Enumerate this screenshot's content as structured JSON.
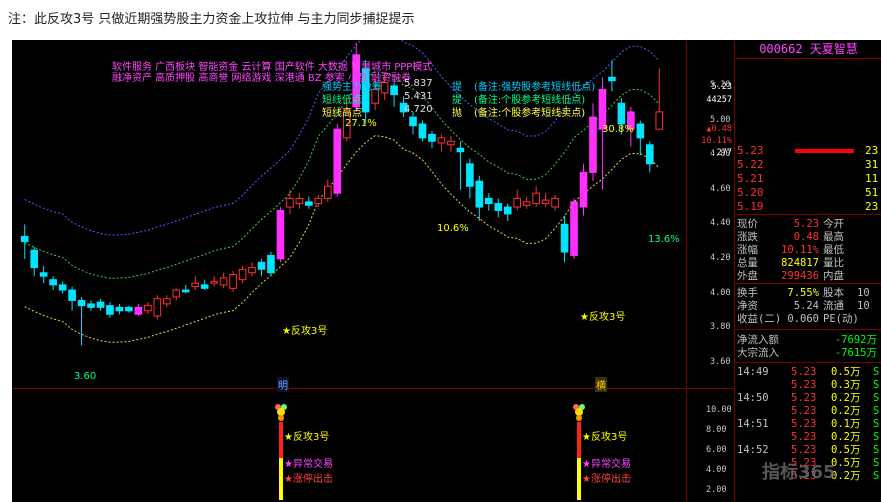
{
  "page": {
    "note": "注：此反攻3号 只做近期强势股主力资金上攻拉伸 与主力同步捕捉提示"
  },
  "header": {
    "tags_line1": "软件服务  广西板块  智能资金 云计算 国产软件 大数据 智慧城市 PPP模式",
    "tags_line2": "融净资产 高质押股 高商誉 网络游戏 深港通 BZ 参索 小盘 融资融券",
    "indicators": [
      {
        "name": "强势主力抢筹",
        "value": "5.837",
        "tag": "提",
        "comment": "(备注:强势股参考短线低点)",
        "color": "#00ccff"
      },
      {
        "name": "短线低点",
        "value": "5.431",
        "tag": "提",
        "comment": "(备注:个股参考短线低点)",
        "color": "#00ff88"
      },
      {
        "name": "短线高点",
        "value": "4.720",
        "tag": "抛",
        "comment": "(备注:个股参考短线卖点)",
        "color": "#ffff44"
      }
    ]
  },
  "right_axis": {
    "top_values": [
      "5.23",
      "44257",
      "▲0.48",
      "10.11%",
      "277"
    ],
    "price_ticks": [
      "5.20",
      "5.00",
      "4.80",
      "4.60",
      "4.40",
      "4.20",
      "4.00",
      "3.80",
      "3.60"
    ],
    "sub_ticks": [
      "10.00",
      "8.00",
      "6.00",
      "4.00",
      "2.00"
    ]
  },
  "annotations": {
    "pct_top1": "27.1%",
    "pct_top2": "30.8%",
    "pct_mid": "10.6%",
    "pct_right": "13.6%",
    "low_label": "3.60",
    "signal_left": "★反攻3号",
    "signal_right": "★反攻3号",
    "marker_left": "明",
    "marker_right": "横"
  },
  "sub_chart": {
    "labels": [
      "★反攻3号",
      "★异常交易",
      "★涨停出击"
    ],
    "label_colors": [
      "#ffff00",
      "#ff44ff",
      "#ff4444"
    ]
  },
  "panel": {
    "title": "000662 天夏智慧",
    "orderbook": [
      {
        "label": "3",
        "price": "5.23",
        "vol": "23",
        "bar": 90
      },
      {
        "label": "5.22",
        "price": "",
        "vol": "31",
        "bar": 0
      },
      {
        "label": "5.21",
        "price": "",
        "vol": "11",
        "bar": 0
      },
      {
        "label": "5.20",
        "price": "",
        "vol": "51",
        "bar": 0
      },
      {
        "label": "5.19",
        "price": "",
        "vol": "23",
        "bar": 0
      }
    ],
    "quotes": [
      {
        "l": "现价",
        "v": "5.23",
        "l2": "今开",
        "v2": "",
        "c": "#ff3030"
      },
      {
        "l": "涨跌",
        "v": "0.48",
        "l2": "最高",
        "v2": "",
        "c": "#ff3030"
      },
      {
        "l": "涨幅",
        "v": "10.11%",
        "l2": "最低",
        "v2": "",
        "c": "#ff3030"
      },
      {
        "l": "总量",
        "v": "824817",
        "l2": "量比",
        "v2": "",
        "c": "#ffff00"
      },
      {
        "l": "外盘",
        "v": "299436",
        "l2": "内盘",
        "v2": "",
        "c": "#ff3030"
      },
      {
        "l": "换手",
        "v": "7.55%",
        "l2": "股本",
        "v2": "10",
        "c": "#ffff00"
      },
      {
        "l": "净资",
        "v": "5.24",
        "l2": "流通",
        "v2": "10",
        "c": "#c0c0c0"
      },
      {
        "l": "收益(二)",
        "v": "0.060",
        "l2": "PE(动)",
        "v2": "",
        "c": "#c0c0c0"
      }
    ],
    "flows": [
      {
        "l": "净流入额",
        "v": "-7692万",
        "c": "#00ff00"
      },
      {
        "l": "大宗流入",
        "v": "-7615万",
        "c": "#00ff00"
      }
    ],
    "trades": [
      {
        "t": "14:49",
        "p": "5.23",
        "v": "0.5万",
        "f": "S"
      },
      {
        "t": "",
        "p": "5.23",
        "v": "0.3万",
        "f": "S"
      },
      {
        "t": "14:50",
        "p": "5.23",
        "v": "0.2万",
        "f": "S"
      },
      {
        "t": "",
        "p": "5.23",
        "v": "0.2万",
        "f": "S"
      },
      {
        "t": "14:51",
        "p": "5.23",
        "v": "0.1万",
        "f": "S"
      },
      {
        "t": "",
        "p": "5.23",
        "v": "0.2万",
        "f": "S"
      },
      {
        "t": "14:52",
        "p": "5.23",
        "v": "0.5万",
        "f": "S"
      },
      {
        "t": "",
        "p": "5.23",
        "v": "0.5万",
        "f": "S"
      },
      {
        "t": "",
        "p": "5.23",
        "v": "0.2万",
        "f": "S"
      }
    ]
  },
  "watermark": "指标365",
  "chart_data": {
    "type": "candlestick",
    "ylim": [
      3.5,
      5.35
    ],
    "candles": [
      [
        4.33,
        4.3,
        4.4,
        4.2,
        "c"
      ],
      [
        4.25,
        4.15,
        4.27,
        4.1,
        "c"
      ],
      [
        4.12,
        4.1,
        4.16,
        4.06,
        "c"
      ],
      [
        4.08,
        4.05,
        4.1,
        4.02,
        "c"
      ],
      [
        4.05,
        4.02,
        4.07,
        4.0,
        "c"
      ],
      [
        4.02,
        3.96,
        4.04,
        3.9,
        "c"
      ],
      [
        3.96,
        3.93,
        3.98,
        3.7,
        "c"
      ],
      [
        3.94,
        3.92,
        3.96,
        3.9,
        "c"
      ],
      [
        3.95,
        3.92,
        3.97,
        3.9,
        "c"
      ],
      [
        3.93,
        3.88,
        3.95,
        3.86,
        "c"
      ],
      [
        3.92,
        3.9,
        3.94,
        3.88,
        "c"
      ],
      [
        3.92,
        3.9,
        3.93,
        3.89,
        "c"
      ],
      [
        3.88,
        3.92,
        3.94,
        3.87,
        "m"
      ],
      [
        3.9,
        3.93,
        3.95,
        3.88,
        "r"
      ],
      [
        3.87,
        3.97,
        3.99,
        3.85,
        "r"
      ],
      [
        3.94,
        3.97,
        3.99,
        3.92,
        "r"
      ],
      [
        3.98,
        4.02,
        4.03,
        3.96,
        "r"
      ],
      [
        4.01,
        4.02,
        4.05,
        4.0,
        "c"
      ],
      [
        4.04,
        4.06,
        4.1,
        4.02,
        "r"
      ],
      [
        4.05,
        4.03,
        4.08,
        4.02,
        "c"
      ],
      [
        4.06,
        4.07,
        4.1,
        4.04,
        "r"
      ],
      [
        4.05,
        4.09,
        4.12,
        4.03,
        "r"
      ],
      [
        4.03,
        4.11,
        4.13,
        4.01,
        "r"
      ],
      [
        4.08,
        4.14,
        4.16,
        4.06,
        "r"
      ],
      [
        4.12,
        4.15,
        4.18,
        4.1,
        "r"
      ],
      [
        4.18,
        4.14,
        4.2,
        4.1,
        "c"
      ],
      [
        4.22,
        4.12,
        4.24,
        4.1,
        "c"
      ],
      [
        4.2,
        4.48,
        4.5,
        4.18,
        "m"
      ],
      [
        4.5,
        4.55,
        4.6,
        4.46,
        "r"
      ],
      [
        4.52,
        4.55,
        4.58,
        4.49,
        "r"
      ],
      [
        4.53,
        4.51,
        4.56,
        4.49,
        "c"
      ],
      [
        4.52,
        4.55,
        4.57,
        4.5,
        "r"
      ],
      [
        4.55,
        4.62,
        4.66,
        4.53,
        "r"
      ],
      [
        4.58,
        4.95,
        4.98,
        4.56,
        "m"
      ],
      [
        4.9,
        5.06,
        5.12,
        4.88,
        "r"
      ],
      [
        5.08,
        5.38,
        5.45,
        5.05,
        "m"
      ],
      [
        5.3,
        5.05,
        5.35,
        4.98,
        "c"
      ],
      [
        5.1,
        5.18,
        5.24,
        5.06,
        "r"
      ],
      [
        5.16,
        5.22,
        5.28,
        5.12,
        "r"
      ],
      [
        5.2,
        5.15,
        5.24,
        5.08,
        "c"
      ],
      [
        5.1,
        5.05,
        5.14,
        5.02,
        "c"
      ],
      [
        5.02,
        4.97,
        5.05,
        4.92,
        "c"
      ],
      [
        4.98,
        4.9,
        5.0,
        4.88,
        "c"
      ],
      [
        4.92,
        4.88,
        4.94,
        4.84,
        "c"
      ],
      [
        4.87,
        4.9,
        4.92,
        4.82,
        "r"
      ],
      [
        4.88,
        4.86,
        4.91,
        4.82,
        "r"
      ],
      [
        4.84,
        4.82,
        4.88,
        4.6,
        "c"
      ],
      [
        4.75,
        4.62,
        4.78,
        4.55,
        "c"
      ],
      [
        4.65,
        4.5,
        4.68,
        4.42,
        "c"
      ],
      [
        4.55,
        4.52,
        4.58,
        4.48,
        "c"
      ],
      [
        4.52,
        4.48,
        4.55,
        4.44,
        "c"
      ],
      [
        4.5,
        4.46,
        4.52,
        4.42,
        "c"
      ],
      [
        4.5,
        4.55,
        4.6,
        4.48,
        "r"
      ],
      [
        4.53,
        4.51,
        4.56,
        4.49,
        "r"
      ],
      [
        4.52,
        4.58,
        4.62,
        4.5,
        "r"
      ],
      [
        4.54,
        4.52,
        4.58,
        4.5,
        "r"
      ],
      [
        4.5,
        4.55,
        4.57,
        4.48,
        "r"
      ],
      [
        4.4,
        4.24,
        4.45,
        4.18,
        "c"
      ],
      [
        4.22,
        4.53,
        4.55,
        4.2,
        "m"
      ],
      [
        4.5,
        4.7,
        4.75,
        4.45,
        "m"
      ],
      [
        4.7,
        5.02,
        5.1,
        4.65,
        "m"
      ],
      [
        4.95,
        5.18,
        5.25,
        4.6,
        "m"
      ],
      [
        5.23,
        5.25,
        5.35,
        5.17,
        "c"
      ],
      [
        5.1,
        4.98,
        5.13,
        4.92,
        "c"
      ],
      [
        5.05,
        4.95,
        5.08,
        4.85,
        "m"
      ],
      [
        4.98,
        4.9,
        5.0,
        4.8,
        "c"
      ],
      [
        4.86,
        4.75,
        4.88,
        4.7,
        "c"
      ],
      [
        4.95,
        5.05,
        5.3,
        4.95,
        "r"
      ]
    ]
  }
}
